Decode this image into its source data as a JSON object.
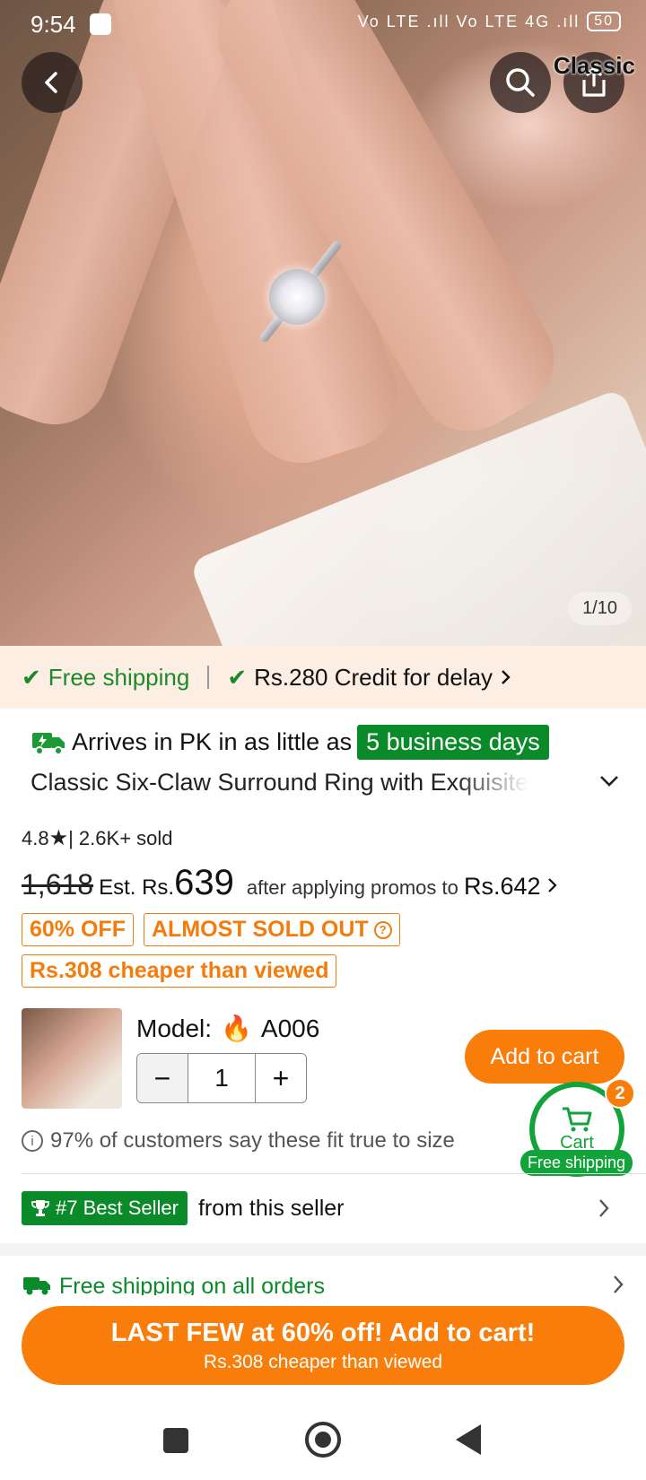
{
  "status_bar": {
    "time": "9:54",
    "signal_text": "Vo LTE .ıll Vo LTE 4G .ıll",
    "battery": "50"
  },
  "hero": {
    "brand_logo": "Classic",
    "pager": "1/10"
  },
  "shipping_bar": {
    "free_shipping": "Free shipping",
    "credit": "Rs.280 Credit for delay"
  },
  "product": {
    "arrive_prefix": "Arrives in PK in as little as",
    "arrive_days": "5 business days",
    "title": "Classic Six-Claw Surround Ring with Exquisite",
    "rating": "4.8",
    "sold": "| 2.6K+ sold",
    "original_price": "1,618",
    "est_label": "Est. Rs.",
    "est_price": "639",
    "promo_text": "after applying promos to",
    "promo_price": "Rs.642",
    "tags": {
      "discount": "60% OFF",
      "almost_sold_out": "ALMOST SOLD OUT",
      "cheaper": "Rs.308 cheaper than viewed"
    },
    "model_label": "Model:",
    "model_value": "A006",
    "quantity": "1",
    "add_to_cart": "Add to cart",
    "fit_text": "97% of customers say these fit true to size"
  },
  "cart_fab": {
    "label": "Cart",
    "count": "2",
    "free_shipping": "Free shipping"
  },
  "best_seller": {
    "badge": "#7 Best Seller",
    "suffix": "from this seller"
  },
  "free_all": "Free shipping on all orders",
  "cta": {
    "line1": "LAST FEW at 60% off! Add to cart!",
    "line2": "Rs.308 cheaper than viewed"
  },
  "colors": {
    "accent_orange": "#f97d0a",
    "green": "#0b8a2a",
    "ship_bar_bg": "#fdeee4"
  }
}
